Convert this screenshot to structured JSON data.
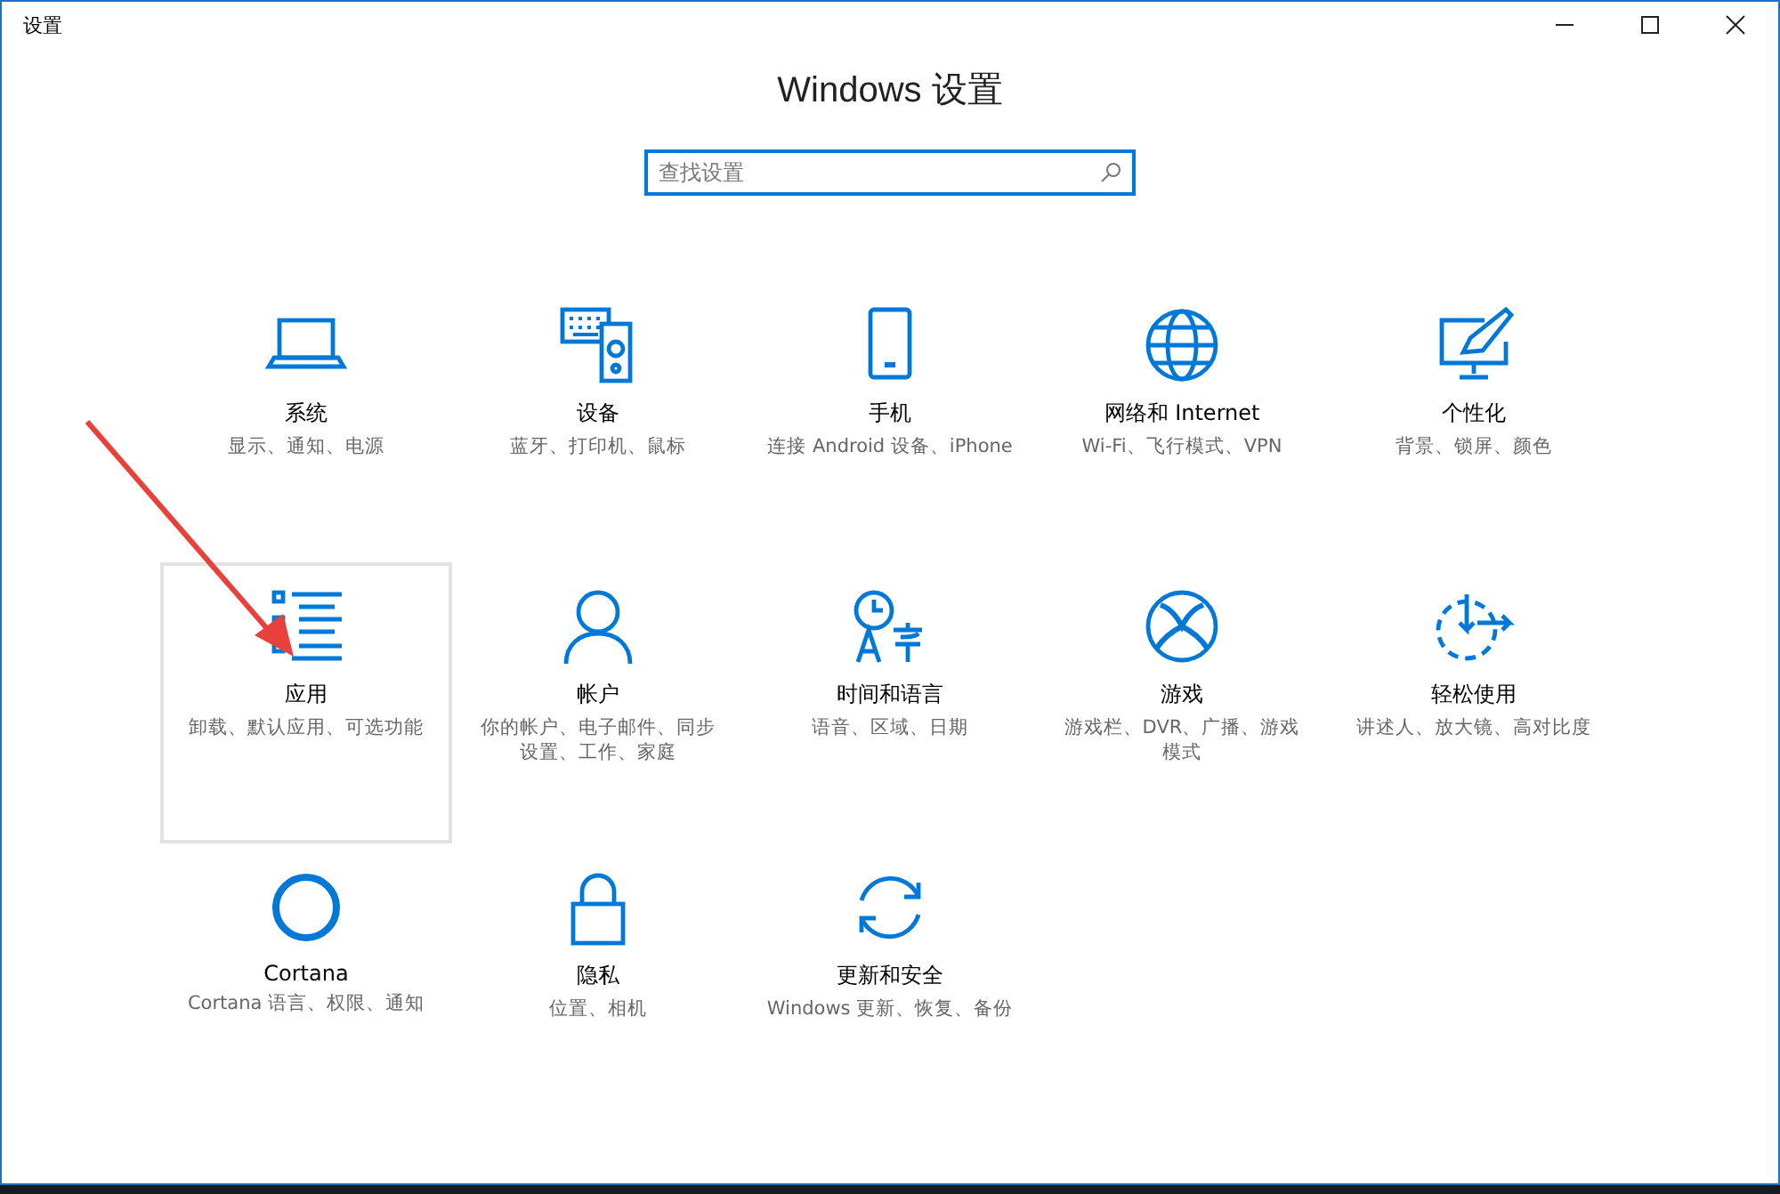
{
  "window": {
    "title": "设置"
  },
  "heading": "Windows 设置",
  "search": {
    "placeholder": "查找设置"
  },
  "tiles": [
    {
      "title": "系统",
      "subtitle": "显示、通知、电源",
      "selected": false
    },
    {
      "title": "设备",
      "subtitle": "蓝牙、打印机、鼠标",
      "selected": false
    },
    {
      "title": "手机",
      "subtitle": "连接 Android 设备、iPhone",
      "selected": false
    },
    {
      "title": "网络和 Internet",
      "subtitle": "Wi-Fi、飞行模式、VPN",
      "selected": false
    },
    {
      "title": "个性化",
      "subtitle": "背景、锁屏、颜色",
      "selected": false
    },
    {
      "title": "应用",
      "subtitle": "卸载、默认应用、可选功能",
      "selected": true
    },
    {
      "title": "帐户",
      "subtitle": "你的帐户、电子邮件、同步设置、工作、家庭",
      "selected": false
    },
    {
      "title": "时间和语言",
      "subtitle": "语音、区域、日期",
      "selected": false
    },
    {
      "title": "游戏",
      "subtitle": "游戏栏、DVR、广播、游戏模式",
      "selected": false
    },
    {
      "title": "轻松使用",
      "subtitle": "讲述人、放大镜、高对比度",
      "selected": false
    },
    {
      "title": "Cortana",
      "subtitle": "Cortana 语言、权限、通知",
      "selected": false
    },
    {
      "title": "隐私",
      "subtitle": "位置、相机",
      "selected": false
    },
    {
      "title": "更新和安全",
      "subtitle": "Windows 更新、恢复、备份",
      "selected": false
    }
  ]
}
